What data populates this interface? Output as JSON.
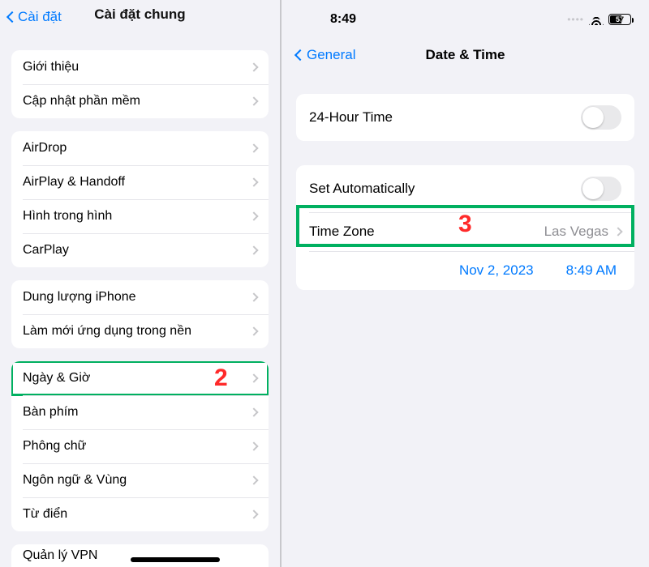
{
  "left": {
    "back": "Cài đặt",
    "title": "Cài đặt chung",
    "groups": [
      [
        "Giới thiệu",
        "Cập nhật phần mềm"
      ],
      [
        "AirDrop",
        "AirPlay & Handoff",
        "Hình trong hình",
        "CarPlay"
      ],
      [
        "Dung lượng iPhone",
        "Làm mới ứng dụng trong nền"
      ],
      [
        "Ngày & Giờ",
        "Bàn phím",
        "Phông chữ",
        "Ngôn ngữ & Vùng",
        "Từ điển"
      ]
    ],
    "bottom_peek": "Quản lý VPN",
    "highlight_index": {
      "group": 3,
      "row": 0
    },
    "callout": "2"
  },
  "right": {
    "status": {
      "time": "8:49",
      "battery": "57"
    },
    "back": "General",
    "title": "Date & Time",
    "rows": {
      "twentyfour": "24-Hour Time",
      "auto": "Set Automatically",
      "tz_label": "Time Zone",
      "tz_value": "Las Vegas",
      "date": "Nov 2, 2023",
      "time": "8:49 AM"
    },
    "callout": "3"
  }
}
